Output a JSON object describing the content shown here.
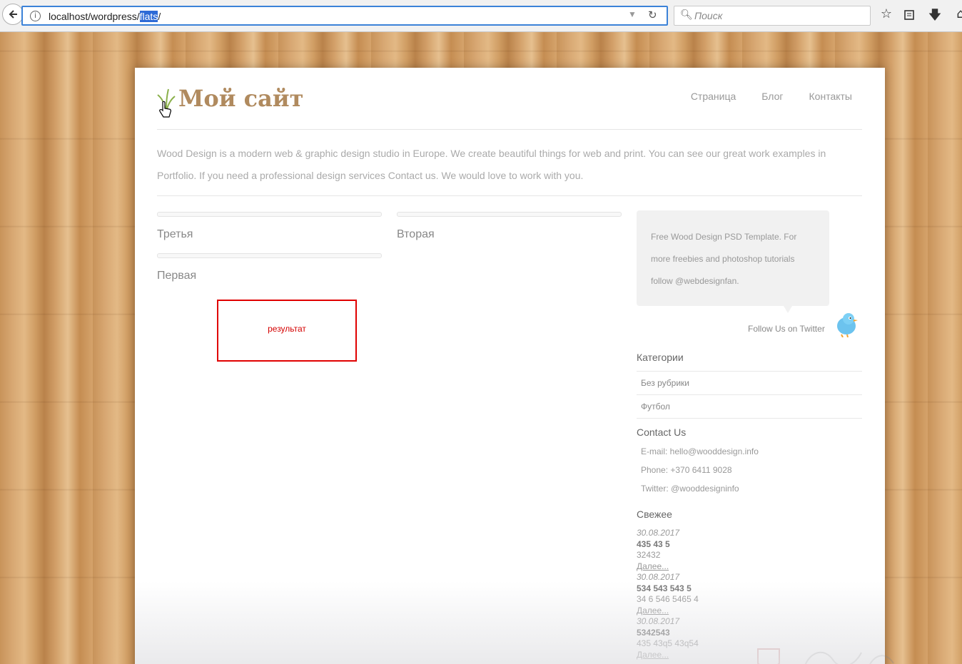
{
  "browser": {
    "url_prefix": "localhost/wordpress/",
    "url_selected": "flats",
    "url_suffix": "/",
    "search_placeholder": "Поиск"
  },
  "header": {
    "site_title": "Мой сайт",
    "nav": [
      "Страница",
      "Блог",
      "Контакты"
    ]
  },
  "intro_text": "Wood Design is a modern web & graphic design studio in Europe. We create beautiful things for web and print. You can see our great work examples in Portfolio. If you need a professional design services Contact us. We would love to work with you.",
  "posts": {
    "col1_first": "Третья",
    "col1_second": "Первая",
    "col2_first": "Вторая"
  },
  "result_label": "результат",
  "sidebar": {
    "tweet": "Free Wood Design PSD Template. For more freebies and photoshop tutorials follow @webdesignfan.",
    "follow": "Follow Us on Twitter",
    "categories_heading": "Категории",
    "categories": [
      "Без рубрики",
      "Футбол"
    ],
    "contact_heading": "Contact Us",
    "contact": [
      "E-mail: hello@wooddesign.info",
      "Phone: +370 6411 9028",
      "Twitter: @wooddesigninfo"
    ],
    "recent_heading": "Свежее",
    "recent": [
      {
        "date": "30.08.2017",
        "title": "435 43 5",
        "excerpt": "32432",
        "more": "Далее..."
      },
      {
        "date": "30.08.2017",
        "title": "534 543 543 5",
        "excerpt": "34 6 546 5465 4",
        "more": "Далее..."
      },
      {
        "date": "30.08.2017",
        "title": "5342543",
        "excerpt": "435 43q5 43q54",
        "more": "Далее..."
      }
    ]
  },
  "colors": {
    "accent": "#3b82d8",
    "title": "#b08a5e",
    "result_border": "#e00000"
  }
}
